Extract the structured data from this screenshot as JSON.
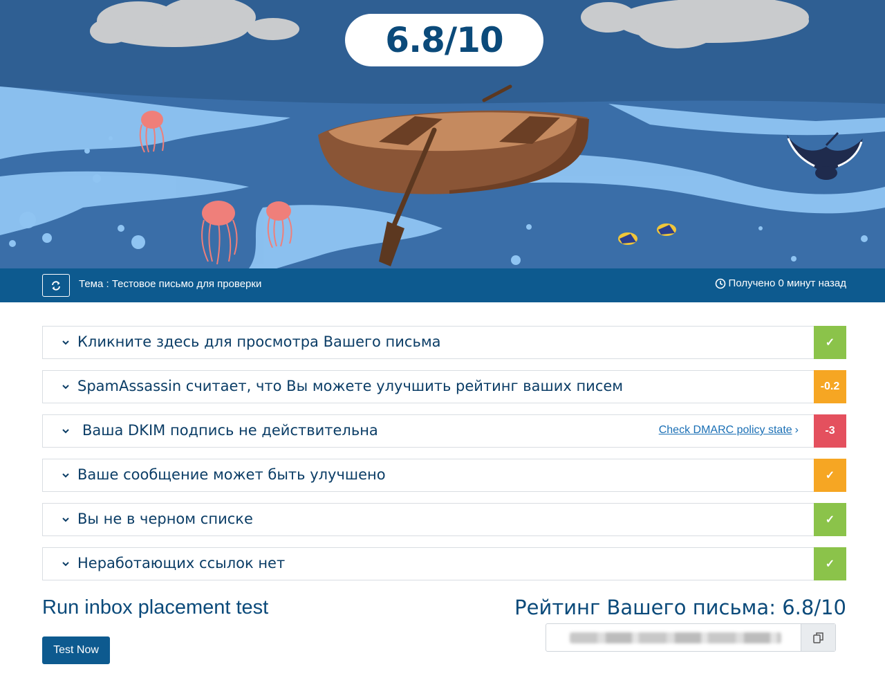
{
  "hero": {
    "score": "6.8/10"
  },
  "infobar": {
    "subject": "Тема : Тестовое письмо для проверки",
    "received": "Получено 0 минут назад"
  },
  "checks": [
    {
      "label": "Кликните здесь для просмотра Вашего письма",
      "badge": "✓",
      "badge_color": "#8bc34a"
    },
    {
      "label": "SpamAssassin считает, что Вы можете улучшить рейтинг ваших писем",
      "badge": "-0.2",
      "badge_color": "#f6a623"
    },
    {
      "label": "Ваша DKIM подпись не действительна",
      "badge": "-3",
      "badge_color": "#e4505e",
      "link": "Check DMARC policy state",
      "link_arrow": "›"
    },
    {
      "label": "Ваше сообщение может быть улучшено",
      "badge": "✓",
      "badge_color": "#f6a623"
    },
    {
      "label": "Вы не в черном списке",
      "badge": "✓",
      "badge_color": "#8bc34a"
    },
    {
      "label": "Неработающих ссылок нет",
      "badge": "✓",
      "badge_color": "#8bc34a"
    }
  ],
  "inbox": {
    "title": "Run inbox placement test",
    "button": "Test Now"
  },
  "rating": {
    "title": "Рейтинг Вашего письма: 6.8/10"
  },
  "colors": {
    "primary": "#0d5a8f",
    "title_text": "#0b4a7a",
    "ok": "#8bc34a",
    "warn": "#f6a623",
    "bad": "#e4505e"
  }
}
